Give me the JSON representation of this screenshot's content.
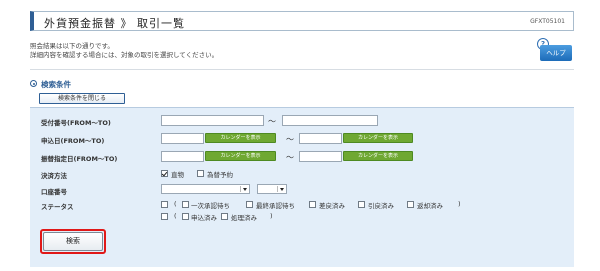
{
  "header": {
    "title": "外貨預金振替 》 取引一覧",
    "screen_id": "GFXT05101"
  },
  "description": {
    "line1": "照会結果は以下の通りです。",
    "line2": "詳細内容を確認する場合には、対象の取引を選択してください。"
  },
  "help": {
    "label": "ヘルプ",
    "icon_glyph": "?"
  },
  "search_section": {
    "title": "検索条件",
    "toggle_label": "検索条件を閉じる",
    "fields": {
      "receipt_no": {
        "label": "受付番号(FROM〜TO)",
        "from_value": "",
        "to_value": ""
      },
      "application_date": {
        "label": "申込日(FROM〜TO)",
        "from_value": "",
        "to_value": "",
        "calendar_label": "カレンダーを表示"
      },
      "transfer_date": {
        "label": "振替指定日(FROM〜TO)",
        "from_value": "",
        "to_value": "",
        "calendar_label": "カレンダーを表示"
      },
      "settlement_method": {
        "label": "決済方法",
        "options": [
          {
            "label": "直物",
            "checked": true
          },
          {
            "label": "為替予約",
            "checked": false
          }
        ]
      },
      "account_no": {
        "label": "口座番号",
        "select1_value": "",
        "select2_value": ""
      },
      "status": {
        "label": "ステータス",
        "row1": [
          "一次承認待ち",
          "最終承認待ち",
          "差戻済み",
          "引戻済み",
          "返却済み"
        ],
        "row2": [
          "申込済み",
          "処理済み"
        ],
        "open_paren": "(",
        "close_paren": ")"
      },
      "tilde": "〜"
    },
    "search_button": "検索"
  }
}
